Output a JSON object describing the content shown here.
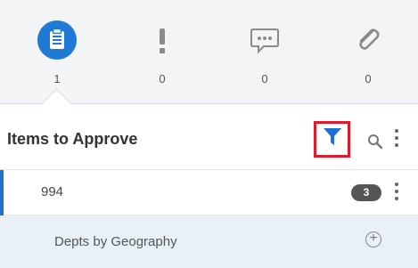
{
  "tabs": [
    {
      "icon": "clipboard-icon",
      "count": "1",
      "active": true
    },
    {
      "icon": "exclamation-icon",
      "count": "0",
      "active": false
    },
    {
      "icon": "chat-icon",
      "count": "0",
      "active": false
    },
    {
      "icon": "paperclip-icon",
      "count": "0",
      "active": false
    }
  ],
  "header": {
    "title": "Items to Approve",
    "icons": [
      "filter-icon",
      "search-icon",
      "more-icon"
    ]
  },
  "items": [
    {
      "label": "994",
      "badge": "3",
      "icon": "more-icon"
    },
    {
      "label": "Depts by Geography",
      "icon": "plus-circle-icon"
    }
  ],
  "colors": {
    "accent": "#1f74c9",
    "active_tab_circle": "#1f7ad6",
    "highlight_border": "#e01b2b",
    "tab_bg": "#f3f4f6",
    "subrow_bg": "#e9f0f8"
  }
}
